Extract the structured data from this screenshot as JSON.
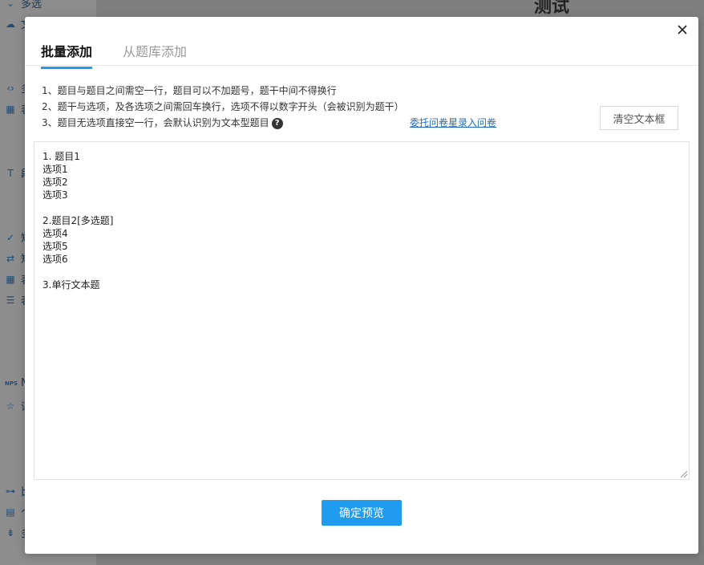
{
  "background": {
    "page_title": "测试",
    "sidebar_items": [
      {
        "icon": "chevron-down-icon",
        "glyph": "⌄",
        "label": "多选"
      },
      {
        "icon": "cloud-upload-icon",
        "glyph": "☁",
        "label": "文"
      },
      {
        "icon": "code-icon",
        "glyph": "‹›",
        "label": "多"
      },
      {
        "icon": "table-icon",
        "glyph": "▦",
        "label": "表"
      },
      {
        "icon": "text-icon",
        "glyph": "T",
        "label": "段"
      },
      {
        "icon": "check-icon",
        "glyph": "✓",
        "label": "矩"
      },
      {
        "icon": "swap-icon",
        "glyph": "⇄",
        "label": "矩"
      },
      {
        "icon": "table-icon",
        "glyph": "▦",
        "label": "表"
      },
      {
        "icon": "list-icon",
        "glyph": "☰",
        "label": "表"
      },
      {
        "icon": "nps-icon",
        "glyph": "NPS",
        "label": "N"
      },
      {
        "icon": "star-icon",
        "glyph": "☆",
        "label": "评"
      },
      {
        "icon": "slider-icon",
        "glyph": "⊶",
        "label": "比"
      },
      {
        "icon": "document-icon",
        "glyph": "▤",
        "label": "个"
      },
      {
        "icon": "sort-icon",
        "glyph": "⇟",
        "label": "多"
      }
    ]
  },
  "modal": {
    "tabs": [
      {
        "label": "批量添加",
        "active": true
      },
      {
        "label": "从题库添加",
        "active": false
      }
    ],
    "hints": [
      "1、题目与题目之间需空一行，题目可以不加题号，题干中间不得换行",
      "2、题干与选项，及各选项之间需回车换行，选项不得以数字开头（会被识别为题干）",
      "3、题目无选项直接空一行，会默认识别为文本型题目"
    ],
    "help_glyph": "?",
    "delegate_link": "委托问卷星录入问卷",
    "clear_button": "清空文本框",
    "editor_lines": [
      "1. 题目1",
      "选项1",
      "选项2",
      "选项3",
      "",
      "2.题目2[多选题]",
      "选项4",
      "选项5",
      "选项6",
      "",
      "3.单行文本题"
    ],
    "confirm_button": "确定预览"
  },
  "colors": {
    "accent": "#1f9cf0",
    "link": "#1e6fbf"
  }
}
